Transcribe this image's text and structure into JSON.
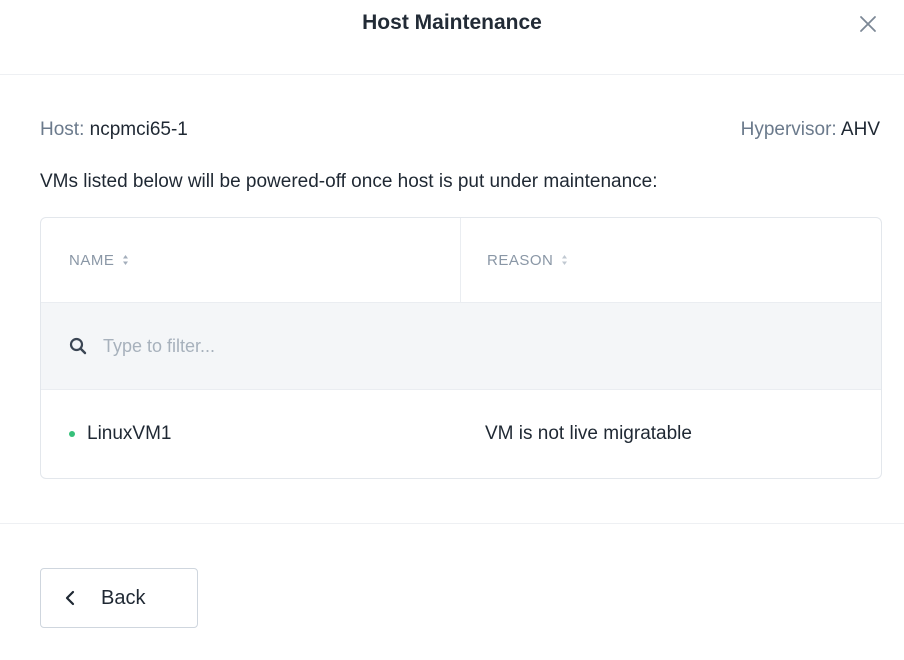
{
  "dialog": {
    "title": "Host Maintenance",
    "close_icon": "close-icon"
  },
  "info": {
    "host_label": "Host:",
    "host_value": "ncpmci65-1",
    "hypervisor_label": "Hypervisor:",
    "hypervisor_value": "AHV"
  },
  "notice": "VMs listed below will be powered-off once host is put under maintenance:",
  "table": {
    "columns": [
      "NAME",
      "REASON"
    ],
    "filter_placeholder": "Type to filter...",
    "rows": [
      {
        "name": "LinuxVM1",
        "reason": "VM is not live migratable",
        "status_color": "#36c07a"
      }
    ]
  },
  "footer": {
    "back_label": "Back"
  }
}
